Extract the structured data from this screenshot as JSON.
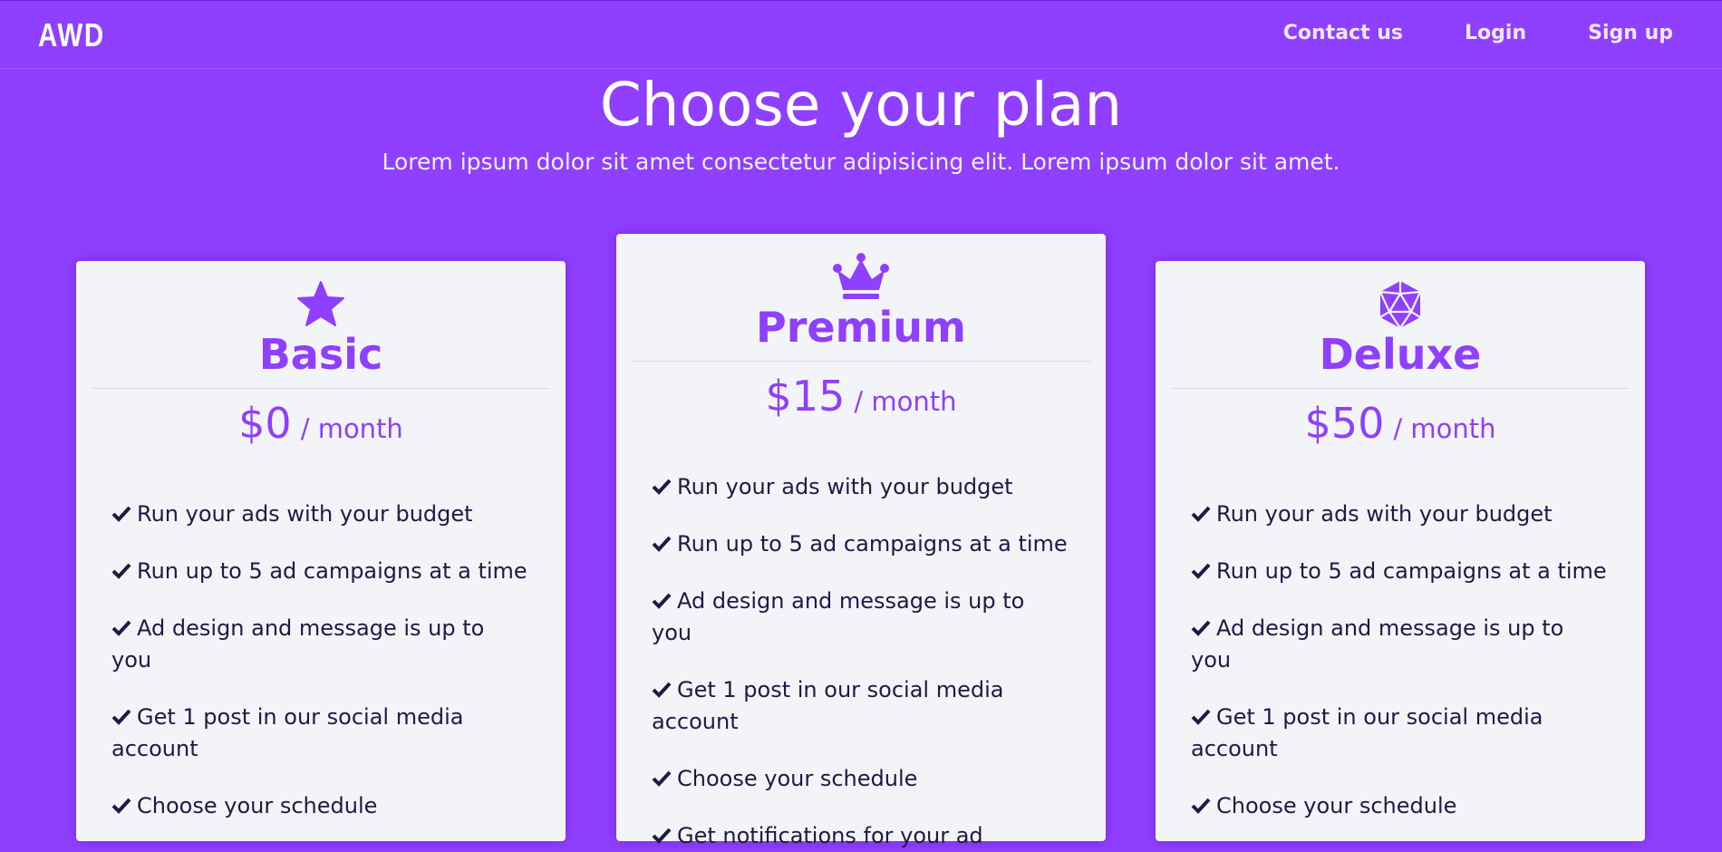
{
  "navbar": {
    "logo_text": "AWD",
    "links": [
      "Contact us",
      "Login",
      "Sign up"
    ]
  },
  "hero": {
    "title": "Choose your plan",
    "subtitle": "Lorem ipsum dolor sit amet consectetur adipisicing elit. Lorem ipsum dolor sit amet."
  },
  "colors": {
    "accent": "#8f3ffe",
    "card_background": "#f3f4f8",
    "text_dark": "#1f1a43"
  },
  "plans": [
    {
      "icon": "star-icon",
      "name": "Basic",
      "price": "$0",
      "period": "/ month",
      "features": [
        "Run your ads with your budget",
        "Run up to 5 ad campaigns at a time",
        "Ad design and message is up to you",
        "Get 1 post in our social media account",
        "Choose your schedule"
      ]
    },
    {
      "icon": "crown-icon",
      "name": "Premium",
      "price": "$15",
      "period": "/ month",
      "features": [
        "Run your ads with your budget",
        "Run up to 5 ad campaigns at a time",
        "Ad design and message is up to you",
        "Get 1 post in our social media account",
        "Choose your schedule",
        "Get notifications for your ad"
      ]
    },
    {
      "icon": "dice-d20-icon",
      "name": "Deluxe",
      "price": "$50",
      "period": "/ month",
      "features": [
        "Run your ads with your budget",
        "Run up to 5 ad campaigns at a time",
        "Ad design and message is up to you",
        "Get 1 post in our social media account",
        "Choose your schedule"
      ]
    }
  ]
}
